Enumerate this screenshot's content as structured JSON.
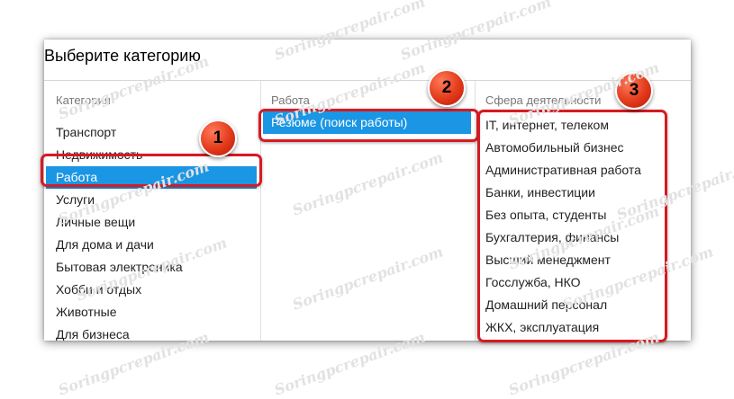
{
  "dialog": {
    "title": "Выберите категорию"
  },
  "columns": {
    "category": {
      "header": "Категория",
      "items": [
        "Транспорт",
        "Недвижимость",
        "Работа",
        "Услуги",
        "Личные вещи",
        "Для дома и дачи",
        "Бытовая электроника",
        "Хобби и отдых",
        "Животные",
        "Для бизнеса"
      ],
      "selected": "Работа"
    },
    "work": {
      "header": "Работа",
      "items": [
        "Резюме (поиск работы)"
      ],
      "selected": "Резюме (поиск работы)"
    },
    "field": {
      "header": "Сфера деятельности",
      "items": [
        "IT, интернет, телеком",
        "Автомобильный бизнес",
        "Административная работа",
        "Банки, инвестиции",
        "Без опыта, студенты",
        "Бухгалтерия, финансы",
        "Высший менеджмент",
        "Госслужба, НКО",
        "Домашний персонал",
        "ЖКХ, эксплуатация"
      ]
    }
  },
  "annotations": [
    "1",
    "2",
    "3"
  ],
  "watermark": "Soringpcrepair.com",
  "colors": {
    "selected_bg": "#1a96e4",
    "highlight_border": "#d71a22",
    "badge": "#e23a1a"
  }
}
